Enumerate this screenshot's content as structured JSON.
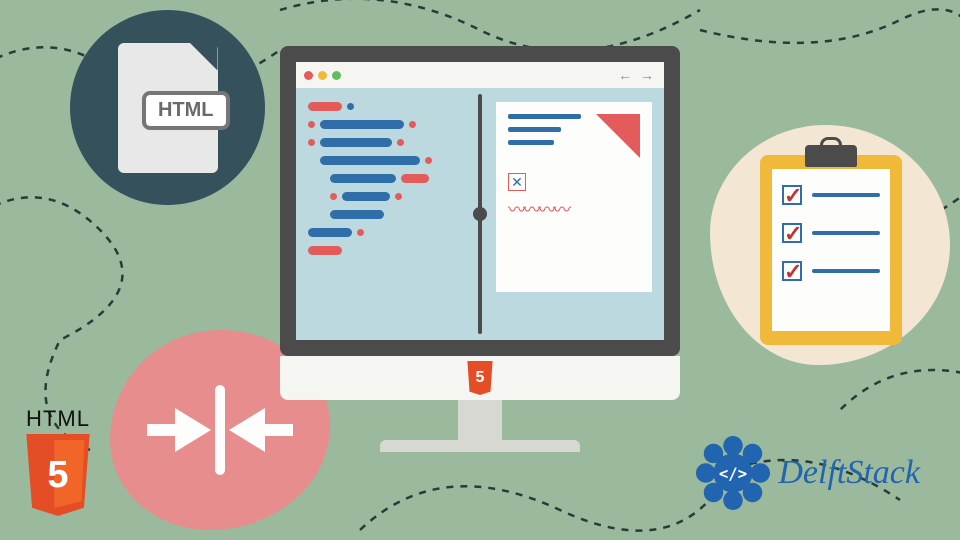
{
  "file_icon": {
    "label": "HTML"
  },
  "html5_logo": {
    "text": "HTML",
    "number": "5"
  },
  "monitor": {
    "shield_number": "5",
    "nav": "← →"
  },
  "clipboard": {
    "items": 3
  },
  "brand": {
    "name": "DelftStack"
  }
}
